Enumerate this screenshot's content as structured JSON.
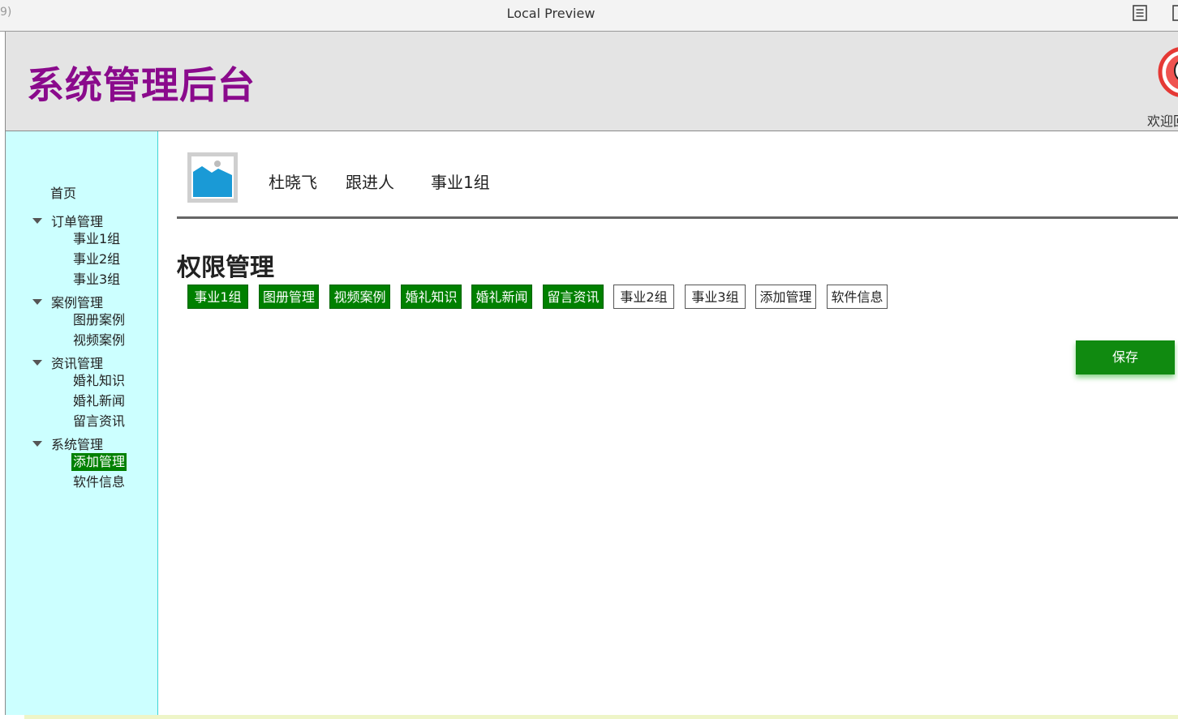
{
  "window": {
    "title": "Local Preview",
    "left_fragment": "9)",
    "icons": [
      "reader-view-icon",
      "window-edge-icon"
    ]
  },
  "header": {
    "app_title": "系统管理后台",
    "welcome": "欢迎回",
    "logo_icon": "avatar-logo-icon"
  },
  "sidebar": {
    "home": "首页",
    "groups": [
      {
        "label": "订单管理",
        "items": [
          "事业1组",
          "事业2组",
          "事业3组"
        ]
      },
      {
        "label": "案例管理",
        "items": [
          "图册案例",
          "视频案例"
        ]
      },
      {
        "label": "资讯管理",
        "items": [
          "婚礼知识",
          "婚礼新闻",
          "留言资讯"
        ]
      },
      {
        "label": "系统管理",
        "items": [
          "添加管理",
          "软件信息"
        ]
      }
    ],
    "active_item": "添加管理"
  },
  "profile": {
    "name": "杜晓飞",
    "role": "跟进人",
    "team": "事业1组",
    "image_icon": "image-placeholder-icon"
  },
  "permissions": {
    "title": "权限管理",
    "tags": [
      {
        "label": "事业1组",
        "selected": true
      },
      {
        "label": "图册管理",
        "selected": true
      },
      {
        "label": "视频案例",
        "selected": true
      },
      {
        "label": "婚礼知识",
        "selected": true
      },
      {
        "label": "婚礼新闻",
        "selected": true
      },
      {
        "label": "留言资讯",
        "selected": true
      },
      {
        "label": "事业2组",
        "selected": false
      },
      {
        "label": "事业3组",
        "selected": false
      },
      {
        "label": "添加管理",
        "selected": false
      },
      {
        "label": "软件信息",
        "selected": false
      }
    ]
  },
  "actions": {
    "save": "保存"
  },
  "colors": {
    "title_purple": "#8a0a8c",
    "header_bg": "#e4e4e4",
    "sidebar_bg": "#ccffff",
    "accent_green": "#008000",
    "save_green": "#108a10"
  }
}
